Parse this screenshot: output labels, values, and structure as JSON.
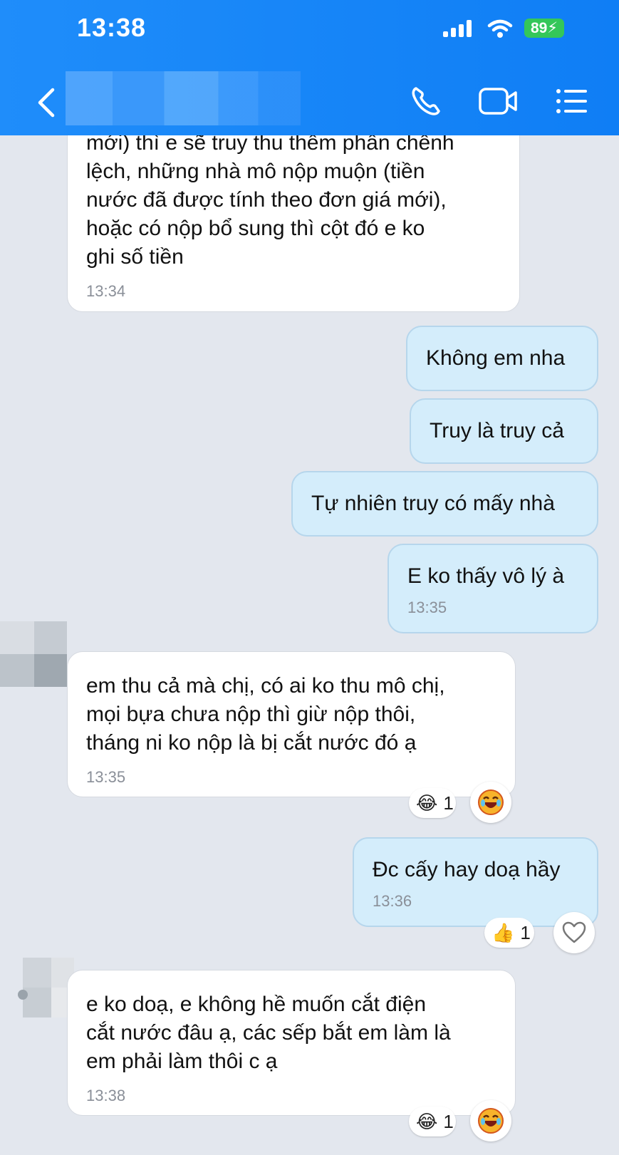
{
  "status_bar": {
    "time": "13:38",
    "battery": "89"
  },
  "header": {
    "back_icon": "chevron-left-icon",
    "call_icon": "phone-icon",
    "video_icon": "video-camera-icon",
    "menu_icon": "list-menu-icon"
  },
  "messages": [
    {
      "dir": "in",
      "text": "mới) thì e sẽ truy thu thêm phần chênh\nlệch, những nhà mô nộp muộn (tiền\nnước đã được tính theo đơn giá mới),\nhoặc có nộp bổ sung thì cột đó e ko\nghi số tiền",
      "time": "13:34"
    },
    {
      "dir": "out",
      "text": "Không em nha"
    },
    {
      "dir": "out",
      "text": "Truy là truy cả"
    },
    {
      "dir": "out",
      "text": "Tự nhiên truy có mấy nhà"
    },
    {
      "dir": "out",
      "text": "E ko thấy vô lý à",
      "time": "13:35"
    },
    {
      "dir": "in",
      "text": "em thu cả mà chị, có ai ko thu mô chị,\nmọi bựa chưa nộp thì giừ nộp thôi,\ntháng ni ko nộp là bị cắt nước đó ạ",
      "time": "13:35",
      "reaction": {
        "emoji": "😂",
        "count": "1"
      }
    },
    {
      "dir": "out",
      "text": "Đc cấy hay doạ hầy",
      "time": "13:36",
      "reaction": {
        "emoji": "👍",
        "count": "1"
      }
    },
    {
      "dir": "in",
      "text": "e ko doạ, e không hề muốn cắt điện\ncắt nước đâu ạ, các sếp bắt em làm là\nem phải làm thôi c ạ",
      "time": "13:38",
      "reaction": {
        "emoji": "😂",
        "count": "1"
      }
    }
  ],
  "react_button_icons": [
    "laugh-emoji-icon",
    "heart-outline-icon",
    "laugh-emoji-icon"
  ]
}
